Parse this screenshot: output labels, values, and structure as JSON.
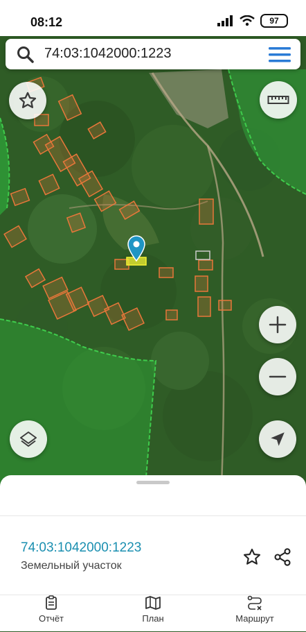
{
  "status_bar": {
    "time": "08:12",
    "battery": "97"
  },
  "search": {
    "query": "74:03:1042000:1223"
  },
  "parcel": {
    "cadastral_number": "74:03:1042000:1223",
    "type": "Земельный участок"
  },
  "tabs": [
    {
      "label": "Отчёт",
      "icon": "report-icon"
    },
    {
      "label": "План",
      "icon": "map-plan-icon"
    },
    {
      "label": "Маршрут",
      "icon": "route-icon"
    }
  ],
  "colors": {
    "accent": "#1a8fb0",
    "parcel_outline": "#e8773a",
    "selected_parcel": "#f4f433",
    "forest_boundary": "#3fcc4c",
    "menu_blue": "#2a7bd6"
  }
}
